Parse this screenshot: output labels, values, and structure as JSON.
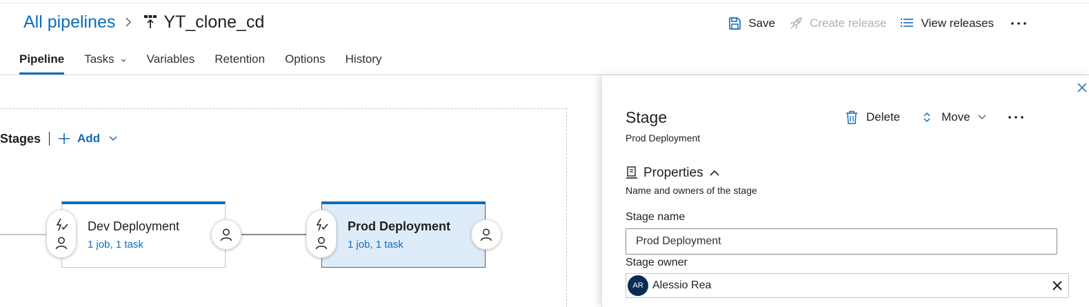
{
  "breadcrumb": {
    "root_label": "All pipelines",
    "separator_icon": "chevron-right-icon",
    "pipeline_icon": "release-pipeline-icon",
    "title": "YT_clone_cd"
  },
  "commands": {
    "save_label": "Save",
    "create_release_label": "Create release",
    "view_releases_label": "View releases",
    "more_icon": "more-icon"
  },
  "tabs": [
    {
      "label": "Pipeline",
      "active": true
    },
    {
      "label": "Tasks",
      "has_dropdown": true
    },
    {
      "label": "Variables"
    },
    {
      "label": "Retention"
    },
    {
      "label": "Options"
    },
    {
      "label": "History"
    }
  ],
  "canvas": {
    "stages_label": "Stages",
    "add_label": "Add",
    "stages": [
      {
        "name": "Dev Deployment",
        "meta": "1 job, 1 task",
        "selected": false
      },
      {
        "name": "Prod Deployment",
        "meta": "1 job, 1 task",
        "selected": true
      }
    ]
  },
  "panel": {
    "title": "Stage",
    "subtitle": "Prod Deployment",
    "delete_label": "Delete",
    "move_label": "Move",
    "section_title": "Properties",
    "section_desc": "Name and owners of the stage",
    "stage_name_label": "Stage name",
    "stage_name_value": "Prod Deployment",
    "stage_owner_label": "Stage owner",
    "owner_initials": "AR",
    "owner_name": "Alessio Rea"
  },
  "colors": {
    "accent": "#0f6cbd",
    "selected_stage_bg": "#deecf9",
    "avatar_bg": "#0b2b57",
    "disabled_text": "#b3b0ad"
  }
}
